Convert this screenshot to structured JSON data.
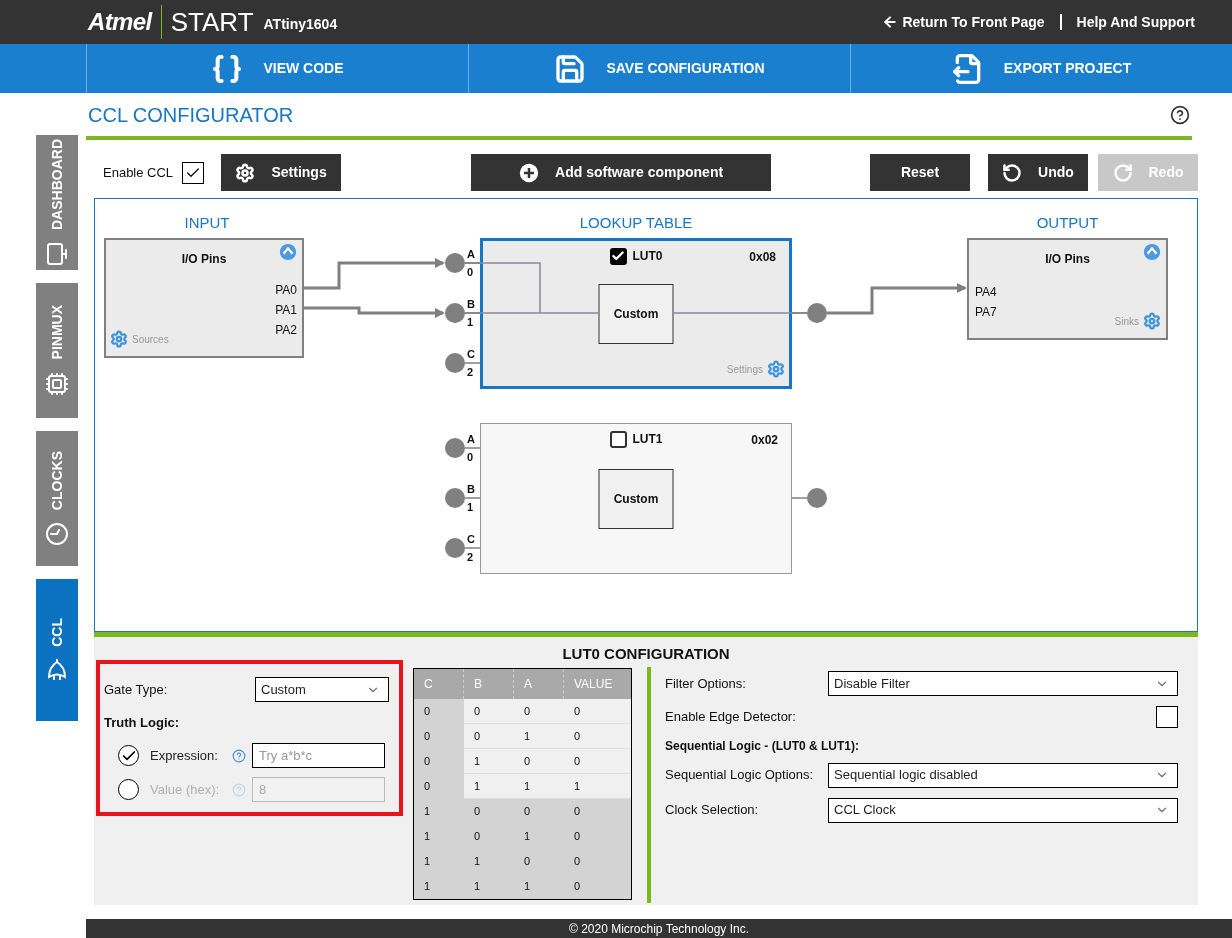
{
  "header": {
    "brand": "Atmel",
    "product": "START",
    "device": "ATtiny1604",
    "links": [
      {
        "label": "Return To Front Page",
        "kind": "back"
      },
      {
        "label": "Help And Support",
        "kind": "plain"
      }
    ]
  },
  "nav": [
    {
      "label": "VIEW CODE",
      "kind": "code"
    },
    {
      "label": "SAVE CONFIGURATION",
      "kind": "save"
    },
    {
      "label": "EXPORT PROJECT",
      "kind": "export"
    }
  ],
  "sidebar": {
    "tabs": [
      {
        "label": "DASHBOARD",
        "kind": "dashboard",
        "selected": false
      },
      {
        "label": "PINMUX",
        "kind": "pinmux",
        "selected": false
      },
      {
        "label": "CLOCKS",
        "kind": "clocks",
        "selected": false
      },
      {
        "label": "CCL",
        "kind": "ccl",
        "selected": true
      }
    ]
  },
  "page_title": "CCL CONFIGURATOR",
  "toolbar": {
    "enable": {
      "label": "Enable CCL",
      "checked": true
    },
    "buttons": [
      {
        "label": "Settings",
        "kind": "settings",
        "disabled": false
      },
      {
        "label": "Add software component",
        "kind": "add",
        "disabled": false
      },
      {
        "label": "Reset",
        "kind": "reset",
        "disabled": false
      },
      {
        "label": "Undo",
        "kind": "undo",
        "disabled": false
      },
      {
        "label": "Redo",
        "kind": "redo",
        "disabled": true
      }
    ]
  },
  "diagram": {
    "input": {
      "heading": "INPUT",
      "title": "I/O Pins",
      "pins": [
        "PA0",
        "PA1",
        "PA2"
      ],
      "footer": "Sources"
    },
    "lookup_heading": "LOOKUP TABLE",
    "luts": [
      {
        "name": "LUT0",
        "enabled": true,
        "selected": true,
        "value": "0x08",
        "gate": "Custom",
        "settings_label": "Settings",
        "inputs": [
          {
            "letter": "A",
            "index": "0"
          },
          {
            "letter": "B",
            "index": "1"
          },
          {
            "letter": "C",
            "index": "2"
          }
        ]
      },
      {
        "name": "LUT1",
        "enabled": false,
        "selected": false,
        "value": "0x02",
        "gate": "Custom",
        "inputs": [
          {
            "letter": "A",
            "index": "0"
          },
          {
            "letter": "B",
            "index": "1"
          },
          {
            "letter": "C",
            "index": "2"
          }
        ]
      }
    ],
    "output": {
      "heading": "OUTPUT",
      "title": "I/O Pins",
      "pins": [
        "PA4",
        "PA7"
      ],
      "footer": "Sinks"
    }
  },
  "config": {
    "title": "LUT0 CONFIGURATION",
    "logic": {
      "highlighted": true,
      "gate_type_label": "Gate Type:",
      "gate_type": "Custom",
      "truth_logic_label": "Truth Logic:",
      "options": [
        {
          "label": "Expression:",
          "placeholder": "Try a*b*c",
          "selected": true
        },
        {
          "label": "Value (hex):",
          "value": "8",
          "selected": false
        }
      ]
    },
    "truth_table": {
      "columns": [
        "C",
        "B",
        "A",
        "VALUE"
      ],
      "rows": [
        {
          "cells": [
            "0",
            "0",
            "0",
            "0"
          ],
          "active": true
        },
        {
          "cells": [
            "0",
            "0",
            "1",
            "0"
          ],
          "active": true
        },
        {
          "cells": [
            "0",
            "1",
            "0",
            "0"
          ],
          "active": true
        },
        {
          "cells": [
            "0",
            "1",
            "1",
            "1"
          ],
          "active": true
        },
        {
          "cells": [
            "1",
            "0",
            "0",
            "0"
          ],
          "active": false
        },
        {
          "cells": [
            "1",
            "0",
            "1",
            "0"
          ],
          "active": false
        },
        {
          "cells": [
            "1",
            "1",
            "0",
            "0"
          ],
          "active": false
        },
        {
          "cells": [
            "1",
            "1",
            "1",
            "0"
          ],
          "active": false
        }
      ]
    },
    "filter": {
      "label": "Filter Options:",
      "value": "Disable Filter"
    },
    "edge_detector": {
      "label": "Enable Edge Detector:",
      "checked": false
    },
    "sequential_heading": "Sequential Logic - (LUT0 & LUT1):",
    "sequential": {
      "label": "Sequential Logic Options:",
      "value": "Sequential logic disabled"
    },
    "clock": {
      "label": "Clock Selection:",
      "value": "CCL Clock"
    }
  },
  "footer": "© 2020 Microchip Technology Inc."
}
